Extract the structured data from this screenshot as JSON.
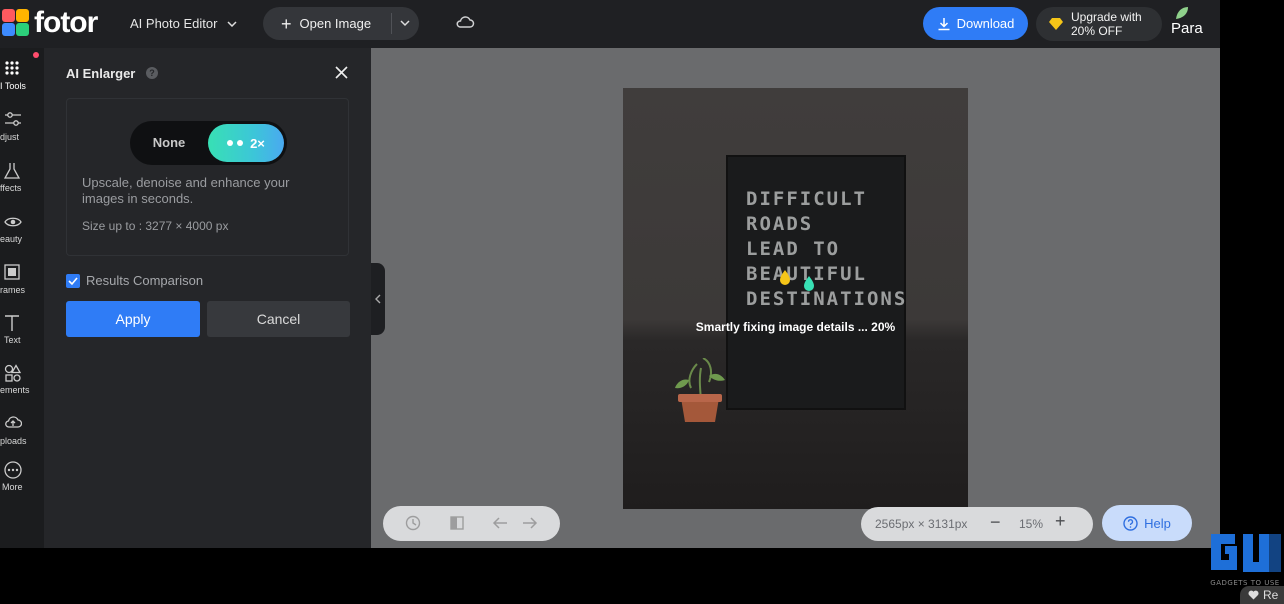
{
  "topbar": {
    "logo_text": "fotor",
    "product_label": "AI Photo Editor",
    "open_image_label": "Open Image",
    "download_label": "Download",
    "upgrade_line1": "Upgrade with",
    "upgrade_line2": "20% OFF",
    "user_name": "Para"
  },
  "rail": {
    "items": [
      {
        "label": "I Tools"
      },
      {
        "label": "djust"
      },
      {
        "label": "ffects"
      },
      {
        "label": "eauty"
      },
      {
        "label": "rames"
      },
      {
        "label": "Text"
      },
      {
        "label": "ements"
      },
      {
        "label": "ploads"
      },
      {
        "label": "More"
      }
    ]
  },
  "panel": {
    "title": "AI Enlarger",
    "help_glyph": "?",
    "toggle_none": "None",
    "toggle_2x": "2×",
    "description": "Upscale, denoise and enhance your images in seconds.",
    "size_text": "Size up to : 3277 × 4000 px",
    "comparison_label": "Results Comparison",
    "comparison_checked": true,
    "apply_label": "Apply",
    "cancel_label": "Cancel"
  },
  "canvas": {
    "board_text": "DIFFICULT\nROADS\nLEAD TO\nBEAUTIFUL\nDESTINATIONS",
    "progress_text": "Smartly fixing image details ... 20%",
    "progress_percent": 20,
    "dimensions": "2565px × 3131px",
    "zoom_minus": "−",
    "zoom": "15%",
    "zoom_plus": "+",
    "help_label": "Help"
  },
  "overlay": {
    "watermark_text": "GADGETS TO USE",
    "tab_label": "Re"
  },
  "colors": {
    "accent": "#2f7cf6",
    "toggle_gradient_start": "#38e0b4",
    "toggle_gradient_end": "#4aa9f0"
  }
}
